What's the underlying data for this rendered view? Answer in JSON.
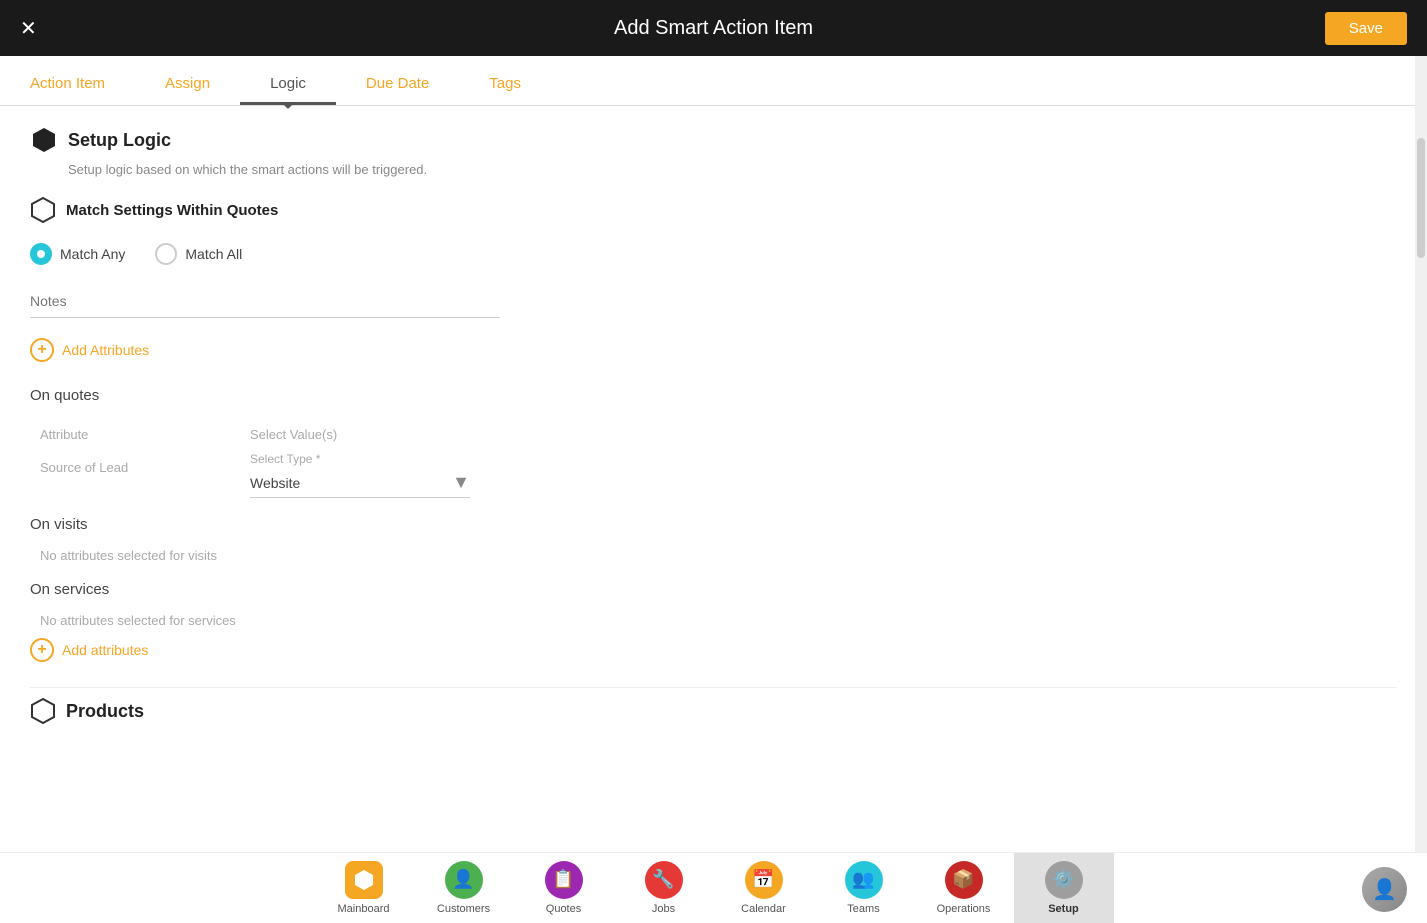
{
  "header": {
    "title": "Add Smart Action Item",
    "close_label": "×",
    "save_label": "Save"
  },
  "tabs": [
    {
      "id": "action-item",
      "label": "Action Item",
      "active": false
    },
    {
      "id": "assign",
      "label": "Assign",
      "active": false
    },
    {
      "id": "logic",
      "label": "Logic",
      "active": true
    },
    {
      "id": "due-date",
      "label": "Due Date",
      "active": false
    },
    {
      "id": "tags",
      "label": "Tags",
      "active": false
    }
  ],
  "setup_logic": {
    "title": "Setup Logic",
    "subtitle": "Setup logic based on which the smart actions will be triggered.",
    "match_settings": {
      "label": "Match Settings Within Quotes",
      "options": [
        {
          "id": "match-any",
          "label": "Match Any",
          "checked": true
        },
        {
          "id": "match-all",
          "label": "Match All",
          "checked": false
        }
      ]
    },
    "notes_placeholder": "Notes",
    "add_attributes_label": "Add Attributes",
    "on_quotes": {
      "label": "On quotes",
      "attribute_col": "Attribute",
      "select_values_col": "Select Value(s)",
      "select_type_label": "Select Type *",
      "attribute_name": "Source of Lead",
      "select_type_value": "Website"
    },
    "on_visits": {
      "label": "On visits",
      "empty_message": "No attributes selected for visits"
    },
    "on_services": {
      "label": "On services",
      "empty_message": "No attributes selected for services",
      "add_attributes_label": "Add attributes"
    },
    "products": {
      "label": "Products"
    }
  },
  "bottom_nav": [
    {
      "id": "mainboard",
      "label": "Mainboard",
      "icon": "🏠",
      "color": "#f5a623",
      "active": false
    },
    {
      "id": "customers",
      "label": "Customers",
      "icon": "👤",
      "color": "#4caf50",
      "active": false
    },
    {
      "id": "quotes",
      "label": "Quotes",
      "icon": "📋",
      "color": "#9c27b0",
      "active": false
    },
    {
      "id": "jobs",
      "label": "Jobs",
      "icon": "🔧",
      "color": "#e53935",
      "active": false
    },
    {
      "id": "calendar",
      "label": "Calendar",
      "icon": "📅",
      "color": "#f5a623",
      "active": false
    },
    {
      "id": "teams",
      "label": "Teams",
      "icon": "👥",
      "color": "#26c6da",
      "active": false
    },
    {
      "id": "operations",
      "label": "Operations",
      "icon": "📦",
      "color": "#c62828",
      "active": false
    },
    {
      "id": "setup",
      "label": "Setup",
      "icon": "⚙️",
      "color": "#757575",
      "active": true
    }
  ]
}
